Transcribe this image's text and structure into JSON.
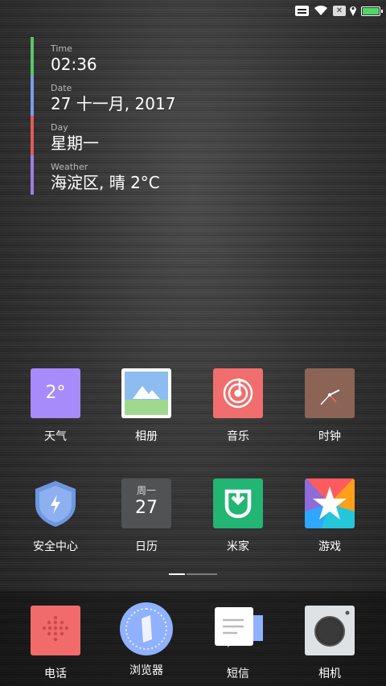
{
  "status_bar": {
    "sim_label": "✕",
    "icons": [
      "notification-icon",
      "wifi-icon",
      "sim-icon",
      "location-icon",
      "battery-icon"
    ],
    "battery_level": 1.0,
    "battery_color": "#4cd964"
  },
  "info_widget": {
    "rows": [
      {
        "label": "Time",
        "value": "02:36",
        "color": "#5cc46a"
      },
      {
        "label": "Date",
        "value": "27 十一月, 2017",
        "color": "#7d9cf0"
      },
      {
        "label": "Day",
        "value": "星期一",
        "color": "#e05b5b"
      },
      {
        "label": "Weather",
        "value": "海淀区, 晴 2°C",
        "color": "#9b7fe6"
      }
    ]
  },
  "apps": [
    {
      "label": "天气",
      "icon": "weather-icon",
      "badge_text": "2°"
    },
    {
      "label": "相册",
      "icon": "gallery-icon"
    },
    {
      "label": "音乐",
      "icon": "music-icon"
    },
    {
      "label": "时钟",
      "icon": "clock-icon"
    },
    {
      "label": "安全中心",
      "icon": "shield-icon"
    },
    {
      "label": "日历",
      "icon": "calendar-icon",
      "day": "周一",
      "date": "27"
    },
    {
      "label": "米家",
      "icon": "mijia-icon"
    },
    {
      "label": "游戏",
      "icon": "games-icon"
    }
  ],
  "page_indicator": {
    "pages": 2,
    "active": 0
  },
  "dock": [
    {
      "label": "电话",
      "icon": "phone-icon"
    },
    {
      "label": "浏览器",
      "icon": "browser-icon"
    },
    {
      "label": "短信",
      "icon": "sms-icon"
    },
    {
      "label": "相机",
      "icon": "camera-icon"
    }
  ]
}
